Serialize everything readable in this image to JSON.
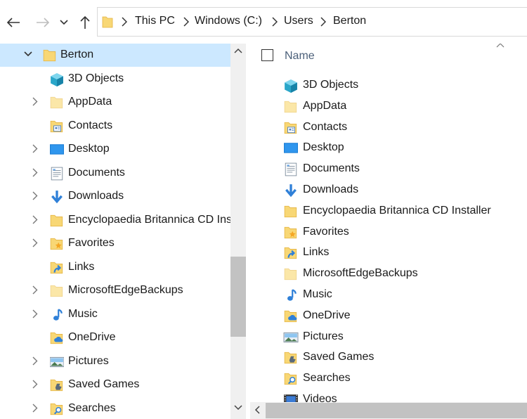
{
  "address_bar": {
    "breadcrumbs": [
      "This PC",
      "Windows (C:)",
      "Users",
      "Berton"
    ]
  },
  "nav_tree": {
    "items": [
      {
        "label": "Berton",
        "icon": "folder-icon",
        "expanded": true,
        "selected": true,
        "level": 0
      },
      {
        "label": "3D Objects",
        "icon": "3d-objects-icon",
        "expandable": false,
        "level": 1
      },
      {
        "label": "AppData",
        "icon": "folder-pale-icon",
        "expandable": true,
        "level": 1
      },
      {
        "label": "Contacts",
        "icon": "contacts-icon",
        "expandable": false,
        "level": 1
      },
      {
        "label": "Desktop",
        "icon": "desktop-icon",
        "expandable": true,
        "level": 1
      },
      {
        "label": "Documents",
        "icon": "documents-icon",
        "expandable": true,
        "level": 1
      },
      {
        "label": "Downloads",
        "icon": "downloads-icon",
        "expandable": true,
        "level": 1
      },
      {
        "label": "Encyclopaedia Britannica CD Ins",
        "icon": "folder-icon",
        "expandable": true,
        "level": 1
      },
      {
        "label": "Favorites",
        "icon": "favorites-icon",
        "expandable": true,
        "level": 1
      },
      {
        "label": "Links",
        "icon": "links-icon",
        "expandable": false,
        "level": 1
      },
      {
        "label": "MicrosoftEdgeBackups",
        "icon": "folder-pale-icon",
        "expandable": true,
        "level": 1
      },
      {
        "label": "Music",
        "icon": "music-icon",
        "expandable": true,
        "level": 1
      },
      {
        "label": "OneDrive",
        "icon": "onedrive-icon",
        "expandable": false,
        "level": 1
      },
      {
        "label": "Pictures",
        "icon": "pictures-icon",
        "expandable": true,
        "level": 1
      },
      {
        "label": "Saved Games",
        "icon": "saved-games-icon",
        "expandable": true,
        "level": 1
      },
      {
        "label": "Searches",
        "icon": "searches-icon",
        "expandable": true,
        "level": 1
      }
    ]
  },
  "file_list": {
    "column_header": "Name",
    "items": [
      {
        "label": "3D Objects",
        "icon": "3d-objects-icon"
      },
      {
        "label": "AppData",
        "icon": "folder-pale-icon"
      },
      {
        "label": "Contacts",
        "icon": "contacts-icon"
      },
      {
        "label": "Desktop",
        "icon": "desktop-icon"
      },
      {
        "label": "Documents",
        "icon": "documents-icon"
      },
      {
        "label": "Downloads",
        "icon": "downloads-icon"
      },
      {
        "label": "Encyclopaedia Britannica CD Installer",
        "icon": "folder-icon"
      },
      {
        "label": "Favorites",
        "icon": "favorites-icon"
      },
      {
        "label": "Links",
        "icon": "links-icon"
      },
      {
        "label": "MicrosoftEdgeBackups",
        "icon": "folder-pale-icon"
      },
      {
        "label": "Music",
        "icon": "music-icon"
      },
      {
        "label": "OneDrive",
        "icon": "onedrive-icon"
      },
      {
        "label": "Pictures",
        "icon": "pictures-icon"
      },
      {
        "label": "Saved Games",
        "icon": "saved-games-icon"
      },
      {
        "label": "Searches",
        "icon": "searches-icon"
      },
      {
        "label": "Videos",
        "icon": "videos-icon"
      }
    ]
  },
  "colors": {
    "selection": "#cce8ff",
    "folder": "#f8d775",
    "header_text": "#4c607a",
    "scrollbar_thumb": "#c2c2c2"
  }
}
